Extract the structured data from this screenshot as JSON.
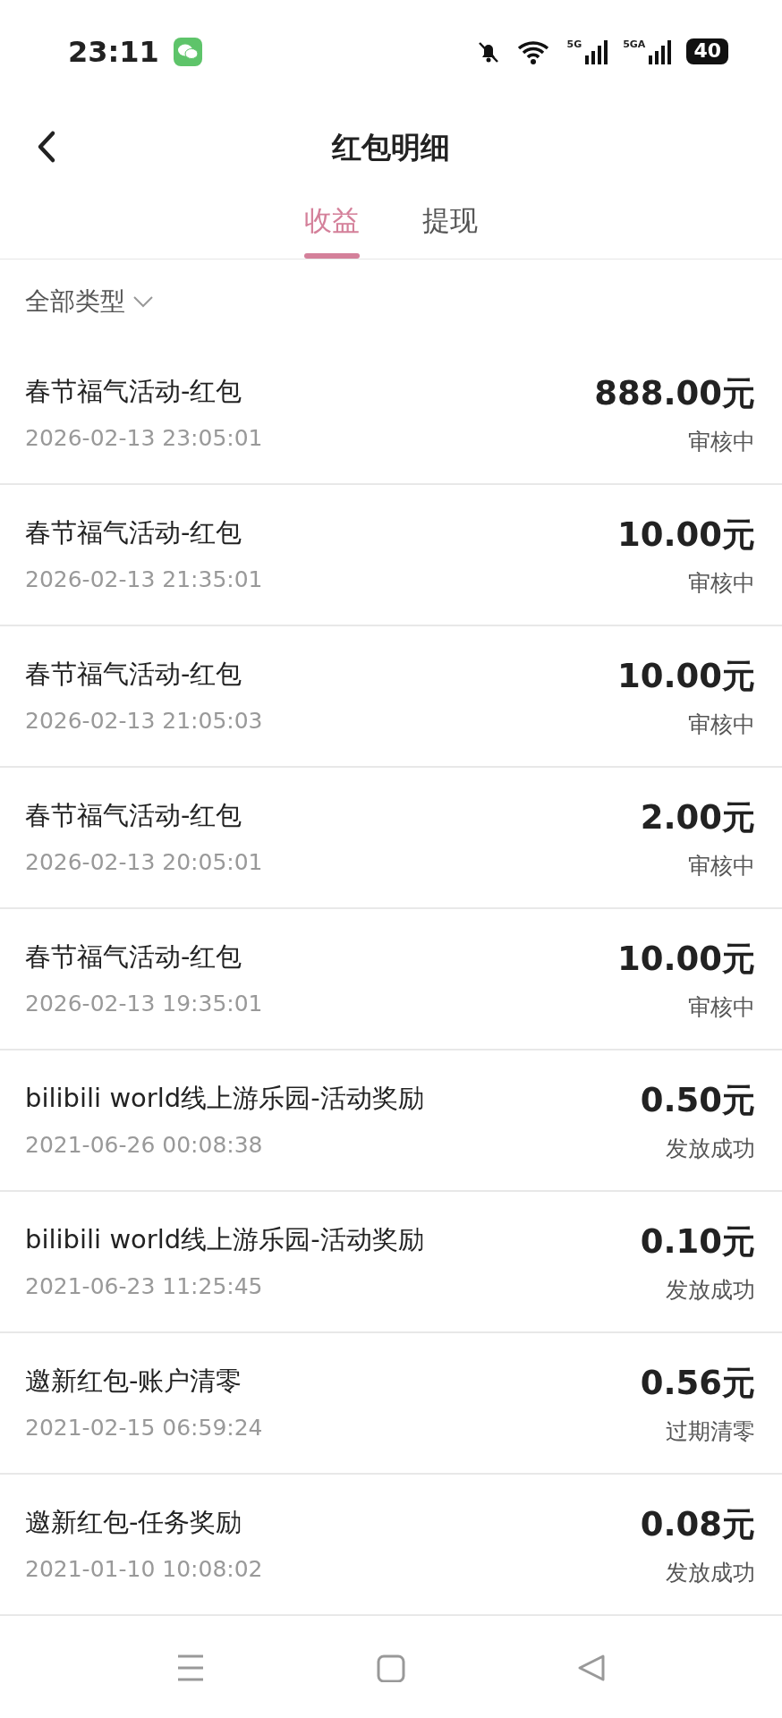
{
  "status_bar": {
    "time": "23:11",
    "network_1": "5G",
    "network_2": "5GA",
    "battery": "40"
  },
  "header": {
    "title": "红包明细"
  },
  "tabs": [
    {
      "label": "收益",
      "selected": true
    },
    {
      "label": "提现",
      "selected": false
    }
  ],
  "filter": {
    "label": "全部类型"
  },
  "records": [
    {
      "title": "春节福气活动-红包",
      "time": "2026-02-13 23:05:01",
      "amount": "888.00元",
      "status": "审核中"
    },
    {
      "title": "春节福气活动-红包",
      "time": "2026-02-13 21:35:01",
      "amount": "10.00元",
      "status": "审核中"
    },
    {
      "title": "春节福气活动-红包",
      "time": "2026-02-13 21:05:03",
      "amount": "10.00元",
      "status": "审核中"
    },
    {
      "title": "春节福气活动-红包",
      "time": "2026-02-13 20:05:01",
      "amount": "2.00元",
      "status": "审核中"
    },
    {
      "title": "春节福气活动-红包",
      "time": "2026-02-13 19:35:01",
      "amount": "10.00元",
      "status": "审核中"
    },
    {
      "title": "bilibili world线上游乐园-活动奖励",
      "time": "2021-06-26 00:08:38",
      "amount": "0.50元",
      "status": "发放成功"
    },
    {
      "title": "bilibili world线上游乐园-活动奖励",
      "time": "2021-06-23 11:25:45",
      "amount": "0.10元",
      "status": "发放成功"
    },
    {
      "title": "邀新红包-账户清零",
      "time": "2021-02-15 06:59:24",
      "amount": "0.56元",
      "status": "过期清零"
    },
    {
      "title": "邀新红包-任务奖励",
      "time": "2021-01-10 10:08:02",
      "amount": "0.08元",
      "status": "发放成功"
    }
  ]
}
